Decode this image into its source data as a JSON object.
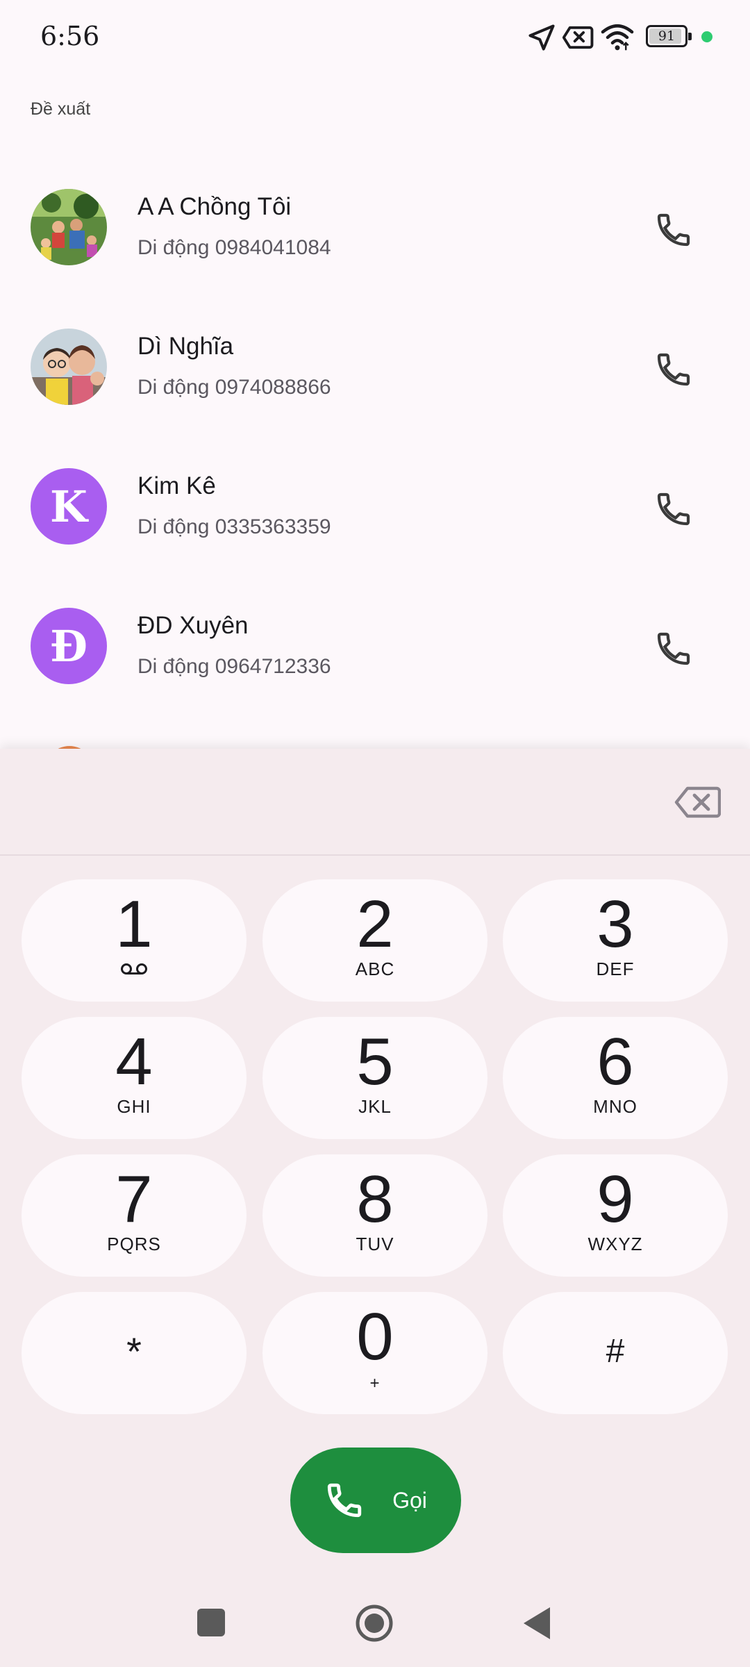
{
  "status_bar": {
    "time": "6:56",
    "battery_level": "91",
    "battery_fraction": 0.91,
    "icons": [
      "location-arrow-icon",
      "no-sim-icon",
      "wifi-icon",
      "battery-icon",
      "privacy-dot-icon"
    ]
  },
  "suggestions": {
    "section_label": "Đề xuất",
    "contacts": [
      {
        "name": "A A Chồng Tôi",
        "subtitle": "Di động 0984041084",
        "avatar": "photo"
      },
      {
        "name": "Dì Nghĩa",
        "subtitle": "Di động 0974088866",
        "avatar": "photo"
      },
      {
        "name": "Kim Kê",
        "subtitle": "Di động 0335363359",
        "avatar_letter": "K"
      },
      {
        "name": "ĐD Xuyên",
        "subtitle": "Di động 0964712336",
        "avatar_letter": "Đ"
      }
    ]
  },
  "dialpad": {
    "keys": [
      {
        "digit": "1",
        "sub": ""
      },
      {
        "digit": "2",
        "sub": "ABC"
      },
      {
        "digit": "3",
        "sub": "DEF"
      },
      {
        "digit": "4",
        "sub": "GHI"
      },
      {
        "digit": "5",
        "sub": "JKL"
      },
      {
        "digit": "6",
        "sub": "MNO"
      },
      {
        "digit": "7",
        "sub": "PQRS"
      },
      {
        "digit": "8",
        "sub": "TUV"
      },
      {
        "digit": "9",
        "sub": "WXYZ"
      },
      {
        "digit": "*",
        "sub": ""
      },
      {
        "digit": "0",
        "sub": "+"
      },
      {
        "digit": "#",
        "sub": ""
      }
    ],
    "call_label": "Gọi"
  },
  "colors": {
    "accent_green": "#1e8e3e",
    "avatar_purple": "#a95ef0",
    "sheet_background": "#f5ebee"
  }
}
